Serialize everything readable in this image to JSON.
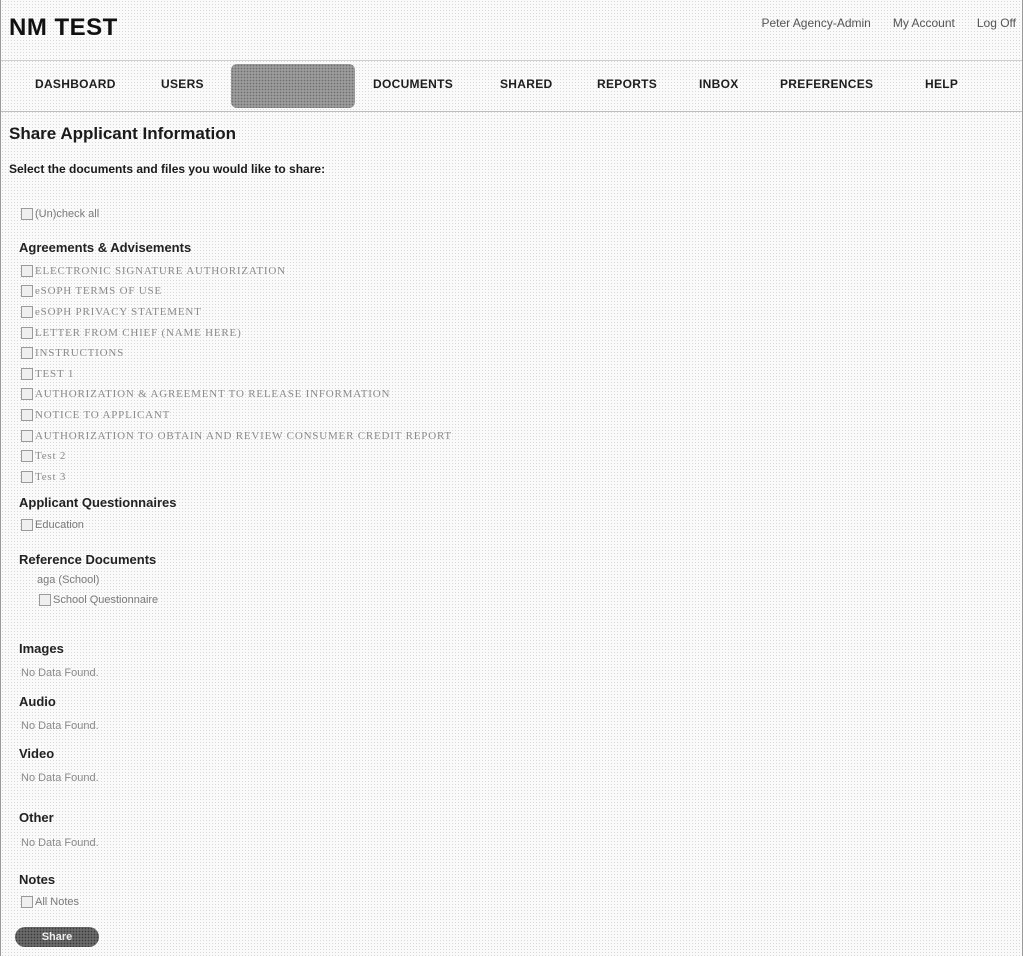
{
  "header": {
    "app_title": "NM TEST",
    "user_name": "Peter Agency-Admin",
    "my_account": "My Account",
    "log_off": "Log Off"
  },
  "nav": {
    "items": [
      {
        "label": "DASHBOARD"
      },
      {
        "label": "USERS"
      },
      {
        "label": ""
      },
      {
        "label": "DOCUMENTS"
      },
      {
        "label": "SHARED"
      },
      {
        "label": "REPORTS"
      },
      {
        "label": "INBOX"
      },
      {
        "label": "PREFERENCES"
      },
      {
        "label": "HELP"
      }
    ],
    "active_index": 2
  },
  "main": {
    "title": "Share Applicant Information",
    "instruction": "Select the documents and files you would like to share:",
    "check_all_label": "(Un)check all",
    "sections": {
      "agreements": {
        "heading": "Agreements & Advisements",
        "items": [
          "ELECTRONIC SIGNATURE AUTHORIZATION",
          "eSOPH TERMS OF USE",
          "eSOPH PRIVACY STATEMENT",
          "LETTER FROM CHIEF (NAME HERE)",
          "INSTRUCTIONS",
          "TEST 1",
          "AUTHORIZATION & AGREEMENT TO RELEASE INFORMATION",
          "NOTICE TO APPLICANT",
          "AUTHORIZATION TO OBTAIN AND REVIEW CONSUMER CREDIT REPORT",
          "Test 2",
          "Test 3"
        ]
      },
      "questionnaires": {
        "heading": "Applicant Questionnaires",
        "items": [
          "Education"
        ]
      },
      "references": {
        "heading": "Reference Documents",
        "group_label": "aga (School)",
        "items": [
          "School Questionnaire"
        ]
      },
      "images": {
        "heading": "Images",
        "empty_text": "No Data Found."
      },
      "audio": {
        "heading": "Audio",
        "empty_text": "No Data Found."
      },
      "video": {
        "heading": "Video",
        "empty_text": "No Data Found."
      },
      "other": {
        "heading": "Other",
        "empty_text": "No Data Found."
      },
      "notes": {
        "heading": "Notes",
        "items": [
          "All Notes"
        ]
      }
    },
    "share_button_label": "Share"
  }
}
